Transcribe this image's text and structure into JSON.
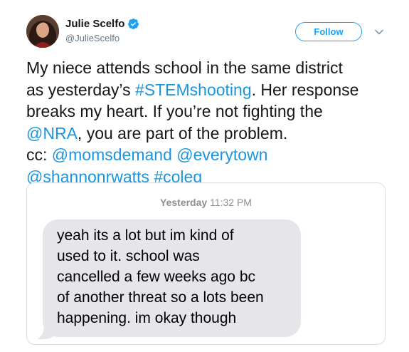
{
  "author": {
    "display_name": "Julie Scelfo",
    "handle": "@JulieScelfo",
    "avatar_icon": "profile-photo",
    "verified_icon": "verified-badge-icon"
  },
  "actions": {
    "follow_label": "Follow",
    "more_icon": "chevron-down-icon"
  },
  "tweet": {
    "segments": [
      [
        {
          "text": "My niece attends school in the same district",
          "link": false
        }
      ],
      [
        {
          "text": "as yesterday’s ",
          "link": false
        },
        {
          "text": "#STEMshooting",
          "link": true
        },
        {
          "text": ". Her response",
          "link": false
        }
      ],
      [
        {
          "text": "breaks my heart. If you’re not fighting the",
          "link": false
        }
      ],
      [
        {
          "text": "@NRA",
          "link": true
        },
        {
          "text": ", you are part of the problem.",
          "link": false
        }
      ],
      [
        {
          "text": "cc: ",
          "link": false
        },
        {
          "text": "@momsdemand",
          "link": true
        },
        {
          "text": " ",
          "link": false
        },
        {
          "text": "@everytown",
          "link": true
        }
      ],
      [
        {
          "text": "@shannonrwatts",
          "link": true
        },
        {
          "text": " ",
          "link": false
        },
        {
          "text": "#coleg",
          "link": true
        }
      ]
    ]
  },
  "message_card": {
    "timestamp_day": "Yesterday",
    "timestamp_time": "11:32 PM",
    "bubble_lines": [
      "yeah its a lot but im kind of",
      "used to it. school was",
      "cancelled a few weeks ago bc",
      "of another threat so a lots been",
      "happening. im okay though"
    ]
  },
  "colors": {
    "link": "#1b95e0",
    "follow": "#1da1f2",
    "bubble": "#e5e5ea",
    "text": "#14171a",
    "secondary": "#657786"
  }
}
